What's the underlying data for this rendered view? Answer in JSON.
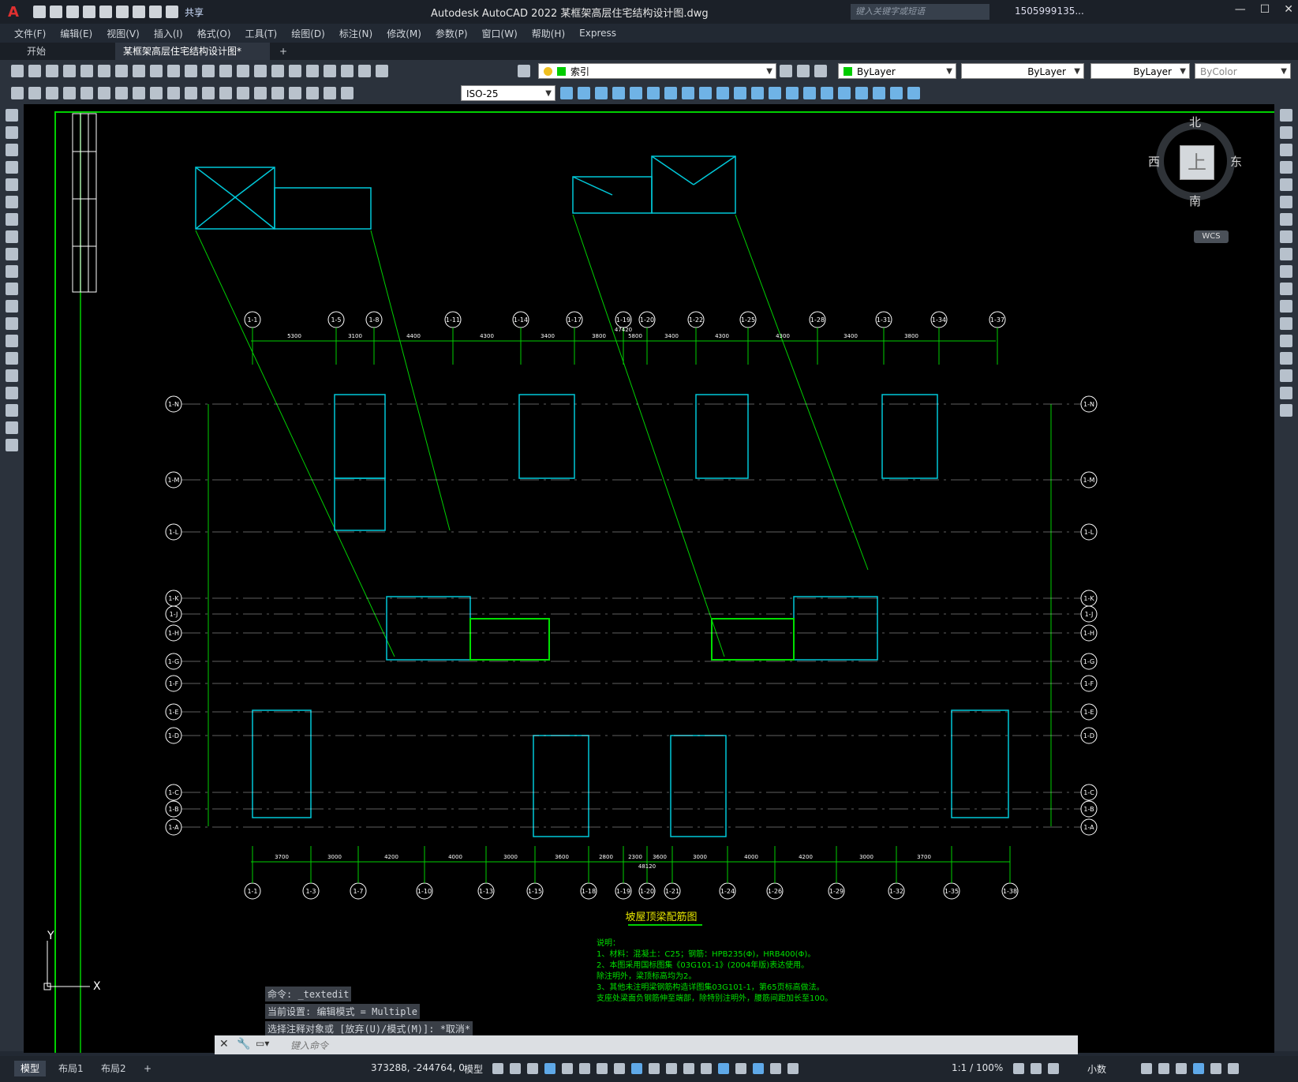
{
  "app": {
    "logo": "A",
    "title": "Autodesk AutoCAD 2022    某框架高层住宅结构设计图.dwg",
    "share": "共享",
    "search_placeholder": "键入关键字或短语",
    "user": "1505999135...",
    "window_buttons": [
      "—",
      "☐",
      "✕"
    ]
  },
  "menu": [
    "文件(F)",
    "编辑(E)",
    "视图(V)",
    "插入(I)",
    "格式(O)",
    "工具(T)",
    "绘图(D)",
    "标注(N)",
    "修改(M)",
    "参数(P)",
    "窗口(W)",
    "帮助(H)",
    "Express"
  ],
  "doc_tabs": [
    {
      "label": "开始",
      "active": false
    },
    {
      "label": "某框架高层住宅结构设计图*",
      "active": true
    },
    {
      "label": "+",
      "active": false
    }
  ],
  "properties": {
    "layer": "索引",
    "color": "ByLayer",
    "linetype": "ByLayer",
    "lineweight": "ByLayer",
    "plotstyle": "ByColor",
    "dimstyle": "ISO-25"
  },
  "viewcube": {
    "north": "北",
    "south": "南",
    "west": "西",
    "east": "东",
    "face": "上",
    "wcs": "WCS"
  },
  "drawing": {
    "title": "坡屋顶梁配筋图",
    "notes_heading": "说明：",
    "notes": [
      "1、材料：混凝土：C25；钢筋：HPB235(Φ)，HRB400(Φ)。",
      "2、本图采用国标图集《03G101-1》(2004年版)表达使用。",
      "   除注明外，梁顶标高均为2。",
      "3、其他未注明梁钢筋构造详图集03G101-1，第65页标高做法。",
      "   支座处梁面负钢筋伸至端部，除特别注明外，腰筋间距加长至100。"
    ],
    "axis_top": [
      "1-1",
      "1-5",
      "1-8",
      "1-11",
      "1-14",
      "1-17",
      "1-19",
      "1-20",
      "1-22",
      "1-25",
      "1-28",
      "1-31",
      "1-34",
      "1-37"
    ],
    "axis_bottom": [
      "1-1",
      "1-3",
      "1-7",
      "1-10",
      "1-13",
      "1-15",
      "1-18",
      "1-19",
      "1-20",
      "1-21",
      "1-24",
      "1-26",
      "1-29",
      "1-32",
      "1-35",
      "1-38"
    ],
    "axis_left": [
      "1-N",
      "1-M",
      "1-L",
      "1-K",
      "1-J",
      "1-H",
      "1-G",
      "1-F",
      "1-E",
      "1-D",
      "1-C",
      "1-B",
      "1-A"
    ],
    "dims_top": [
      "5300",
      "3100",
      "4400",
      "4300",
      "3400",
      "3800",
      "5800",
      "3400",
      "4300",
      "4300",
      "3400",
      "3800"
    ],
    "dim_total_top": "47420",
    "dims_bottom": [
      "3700",
      "3000",
      "4200",
      "4000",
      "3000",
      "3600",
      "2800",
      "2300",
      "3600",
      "3000",
      "4000",
      "4200",
      "3000",
      "3700"
    ],
    "dim_total_bottom": "48120"
  },
  "command": {
    "history": [
      "命令: _textedit",
      "当前设置: 编辑模式 = Multiple",
      "选择注释对象或 [放弃(U)/模式(M)]: *取消*"
    ],
    "placeholder": "键入命令"
  },
  "status": {
    "layout_tabs": [
      "模型",
      "布局1",
      "布局2",
      "+"
    ],
    "coords": "373288, -244764, 0",
    "space": "模型",
    "scale": "1:1 / 100%",
    "units": "小数"
  },
  "colors": {
    "background": "#000000",
    "axis_green": "#00e000",
    "beam_cyan": "#00c8d8",
    "annotation_yellow": "#e8e800"
  }
}
